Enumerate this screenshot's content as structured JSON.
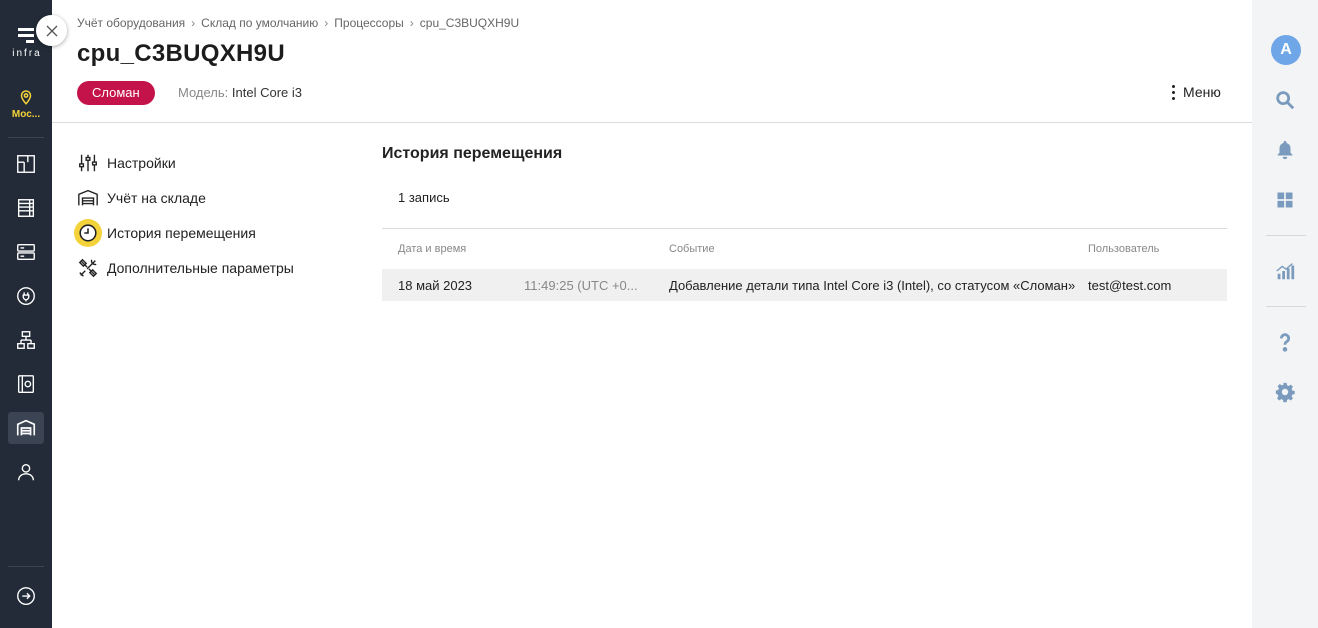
{
  "app": {
    "logo_text": "infra",
    "location_label": "Мос..."
  },
  "breadcrumb": {
    "items": [
      "Учёт оборудования",
      "Склад по умолчанию",
      "Процессоры",
      "cpu_C3BUQXH9U"
    ],
    "separator": "›"
  },
  "page": {
    "title": "cpu_C3BUQXH9U",
    "status_badge": "Сломан",
    "status_color": "#c4134b",
    "model_label": "Модель:",
    "model_value": "Intel Core i3",
    "menu_label": "Меню"
  },
  "subnav": {
    "items": [
      {
        "label": "Настройки",
        "icon": "sliders-icon"
      },
      {
        "label": "Учёт на складе",
        "icon": "warehouse-icon"
      },
      {
        "label": "История перемещения",
        "icon": "clock-icon",
        "active": true
      },
      {
        "label": "Дополнительные параметры",
        "icon": "tools-icon"
      }
    ]
  },
  "history": {
    "title": "История перемещения",
    "count": "1 запись",
    "columns": [
      "Дата и время",
      "Событие",
      "Пользователь"
    ],
    "rows": [
      {
        "date": "18 май 2023",
        "time": "11:49:25 (UTC +0...",
        "event": "Добавление детали типа Intel Core i3 (Intel), со статусом «Сломан»",
        "user": "test@test.com"
      }
    ]
  },
  "user": {
    "avatar_letter": "A"
  },
  "colors": {
    "sidebar_bg": "#222b37",
    "accent_yellow": "#f4d23a",
    "avatar_blue": "#6ea6e8",
    "right_icons": "#7a9bbd"
  }
}
